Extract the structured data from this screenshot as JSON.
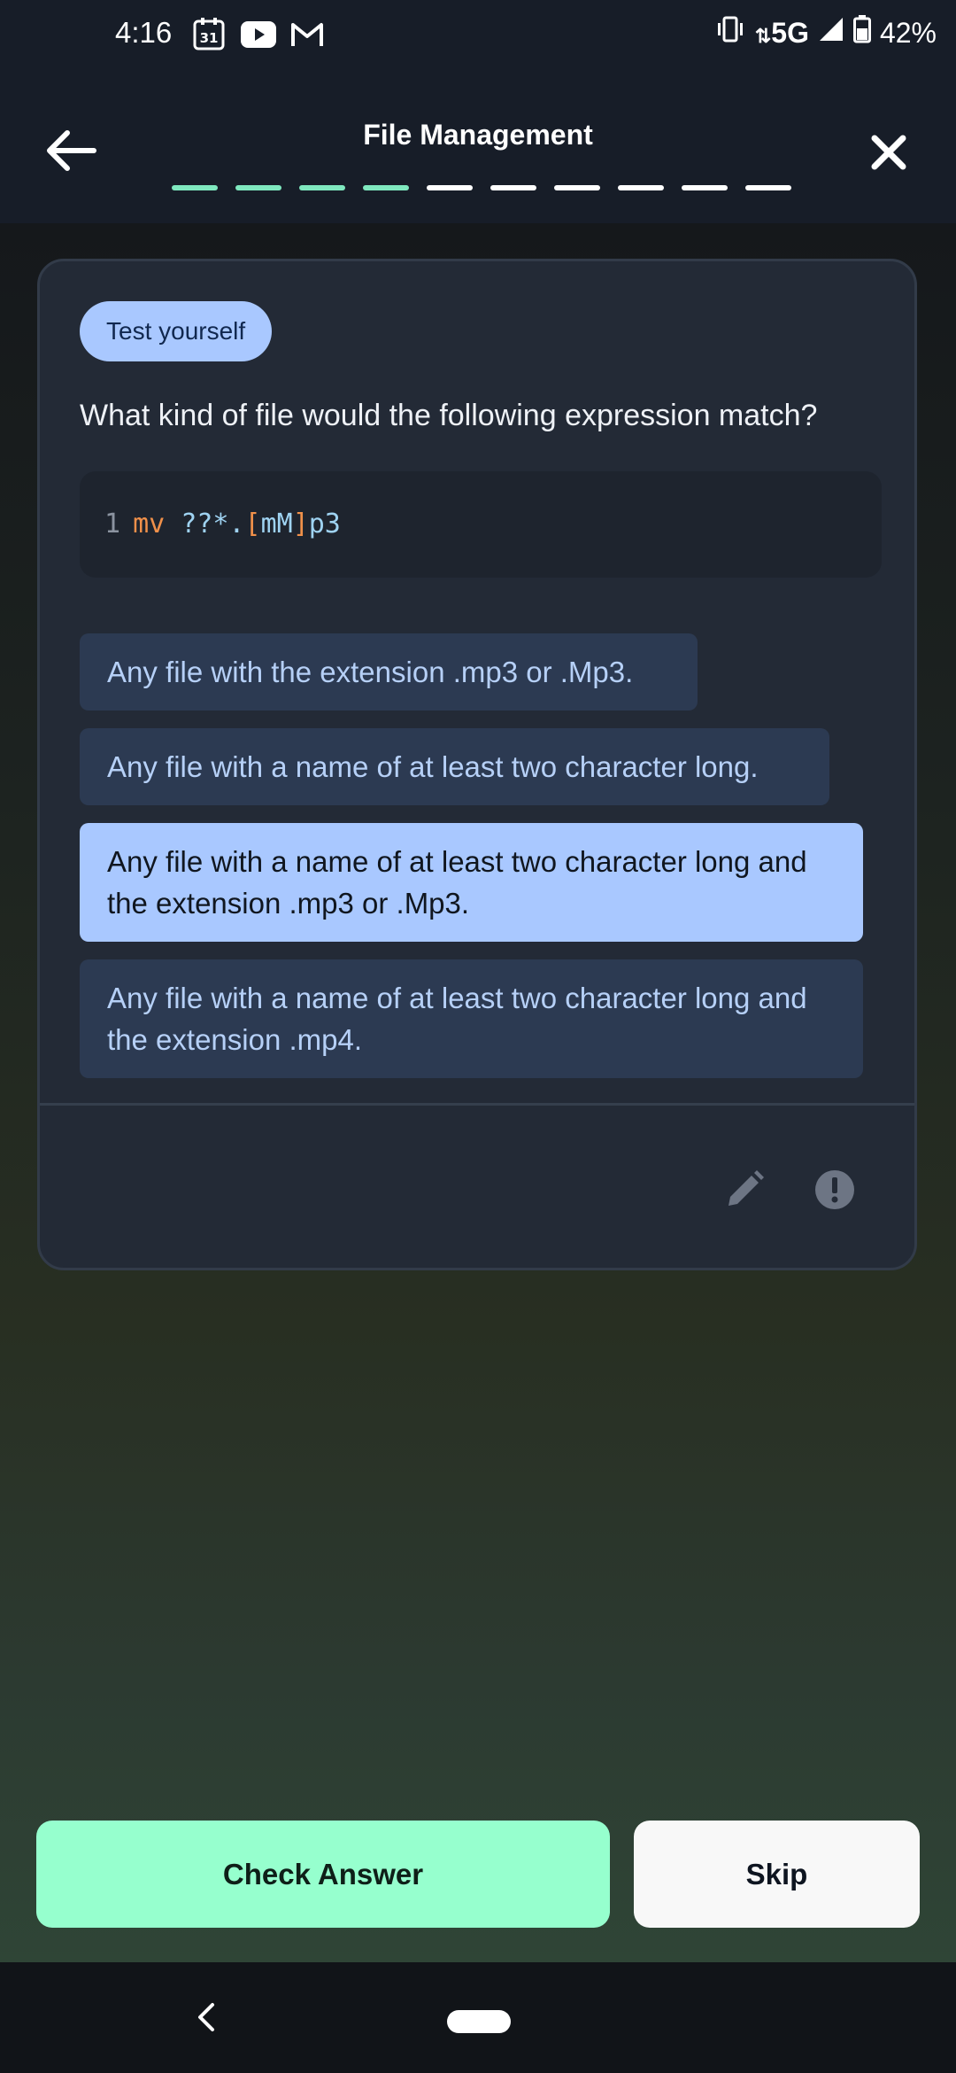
{
  "status_bar": {
    "time": "4:16",
    "calendar_day": "31",
    "network": "5G",
    "battery": "42%"
  },
  "header": {
    "title": "File Management",
    "progress": {
      "total": 10,
      "completed": 4
    },
    "accent_color": "#7fe8bf"
  },
  "card": {
    "badge": "Test yourself",
    "question": "What kind of file would the following expression match?",
    "code": {
      "line_number": "1",
      "command": "mv",
      "glob": "??*.",
      "bracket_open": "[",
      "bracket_content": "mM",
      "bracket_close": "]",
      "suffix": "p3"
    },
    "options": [
      {
        "text": "Any file with the extension .mp3 or .Mp3.",
        "selected": false
      },
      {
        "text": "Any file with a name of at least two character long.",
        "selected": false
      },
      {
        "text": "Any file with a name of at least two character long and the extension .mp3 or .Mp3.",
        "selected": true
      },
      {
        "text": "Any file with a name of at least two character long and the extension .mp4.",
        "selected": false
      }
    ]
  },
  "actions": {
    "check_label": "Check Answer",
    "skip_label": "Skip",
    "check_color": "#96ffce"
  }
}
